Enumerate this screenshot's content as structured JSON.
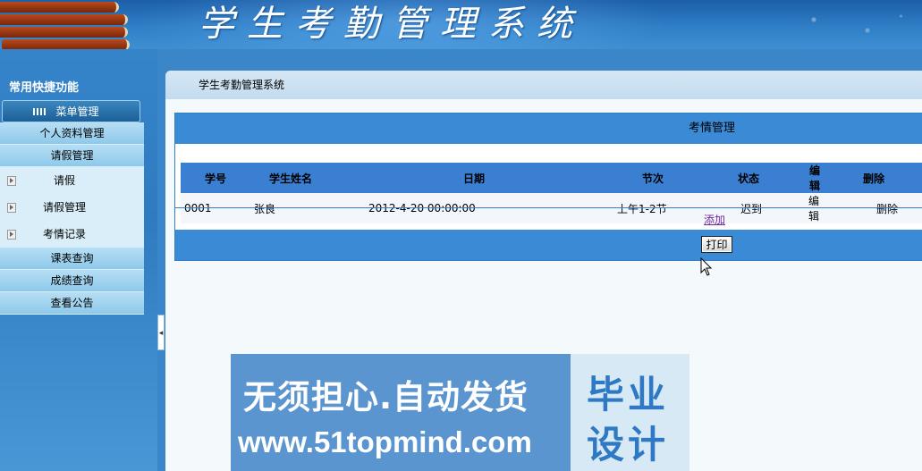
{
  "banner": {
    "title": "学生考勤管理系统"
  },
  "sidebar": {
    "title": "常用快捷功能",
    "menu_head": "菜单管理",
    "items": [
      {
        "label": "个人资料管理",
        "type": "category"
      },
      {
        "label": "请假管理",
        "type": "category"
      },
      {
        "label": "请假",
        "type": "sub"
      },
      {
        "label": "请假管理",
        "type": "sub"
      },
      {
        "label": "考情记录",
        "type": "sub"
      },
      {
        "label": "课表查询",
        "type": "category"
      },
      {
        "label": "成绩查询",
        "type": "category"
      },
      {
        "label": "查看公告",
        "type": "category"
      }
    ]
  },
  "main": {
    "breadcrumb": "学生考勤管理系统",
    "panel_title": "考情管理",
    "columns": [
      "学号",
      "学生姓名",
      "日期",
      "节次",
      "状态",
      "编辑",
      "删除"
    ],
    "rows": [
      {
        "id": "0001",
        "name": "张良",
        "date": "2012-4-20 00:00:00",
        "period": "上午1-2节",
        "status": "迟到",
        "edit": "编辑",
        "delete": "删除"
      }
    ],
    "add_link": "添加",
    "print_button": "打印"
  },
  "watermark": {
    "line1": "无须担心.自动发货",
    "line2": "www.51topmind.com",
    "right1": "毕业",
    "right2": "设计"
  },
  "colors": {
    "accent": "#3b8ad6",
    "header_bg": "#2f7fc7",
    "link": "#6d2a9c"
  }
}
